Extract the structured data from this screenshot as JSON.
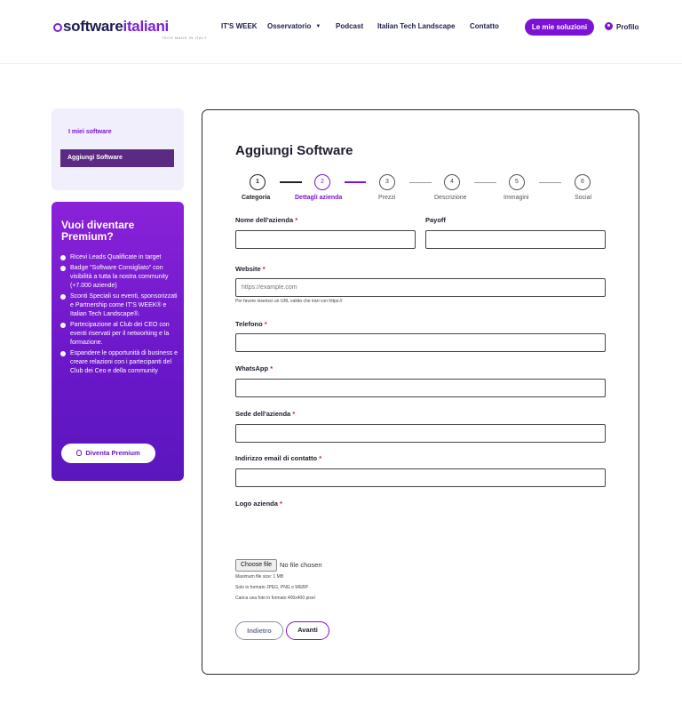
{
  "header": {
    "logo_part1": "software",
    "logo_part2": "italiani",
    "logo_tagline": "TECH MADE IN ITALY",
    "nav": {
      "itsweek": "IT'S WEEK",
      "osservatorio": "Osservatorio",
      "podcast": "Podcast",
      "landscape": "Italian Tech Landscape",
      "contatto": "Contatto"
    },
    "solutions_button": "Le mie soluzioni",
    "profile": "Profilo"
  },
  "sidebar": {
    "my_software": "I miei software",
    "add_software": "Aggiungi Software"
  },
  "premium": {
    "title": "Vuoi diventare Premium?",
    "benefits": [
      "Ricevi Leads Qualificate in target",
      "Badge \"Software Consigliato\" con visibilità a tutta la nostra community (+7.000 aziende)",
      "Sconti Speciali su eventi, sponsorizzati e Partnership come IT'S WEEK® e Italian Tech Landscape®.",
      "Partecipazione al Club dei CEO con eventi riservati per il networking e la formazione.",
      "Espandere le opportunità di business e creare relazioni con i partecipanti del Club dei Ceo e della community"
    ],
    "button": "Diventa Premium"
  },
  "form": {
    "title": "Aggiungi Software",
    "steps": [
      {
        "num": "1",
        "label": "Categoria"
      },
      {
        "num": "2",
        "label": "Dettagli azienda"
      },
      {
        "num": "3",
        "label": "Prezzi"
      },
      {
        "num": "4",
        "label": "Descrizione"
      },
      {
        "num": "5",
        "label": "Immagini"
      },
      {
        "num": "6",
        "label": "Social"
      }
    ],
    "current_step": 2,
    "required_mark": "*",
    "fields": {
      "company_name": {
        "label": "Nome dell'azienda",
        "value": ""
      },
      "payoff": {
        "label": "Payoff",
        "value": ""
      },
      "website": {
        "label": "Website",
        "placeholder": "https://example.com",
        "help": "Per favore inserisci un URL valido che inizi con https://"
      },
      "phone": {
        "label": "Telefono",
        "value": ""
      },
      "whatsapp": {
        "label": "WhatsApp",
        "value": ""
      },
      "hq": {
        "label": "Sede dell'azienda",
        "value": ""
      },
      "email": {
        "label": "Indirizzo email di contatto",
        "value": ""
      },
      "logo": {
        "label": "Logo azienda",
        "file_button": "Choose file",
        "file_status": "No file chosen",
        "help": [
          "Maximum file size: 1 MB",
          "Solo in formato JPEG, PNG o WEBP",
          "Carica una foto in formato 400x400 pixel"
        ]
      }
    },
    "buttons": {
      "back": "Indietro",
      "next": "Avanti"
    }
  },
  "colors": {
    "accent": "#7b12d6",
    "brand_dark": "#1c1c4e",
    "sidebar_active": "#5b2a83",
    "required": "#d4102e"
  }
}
